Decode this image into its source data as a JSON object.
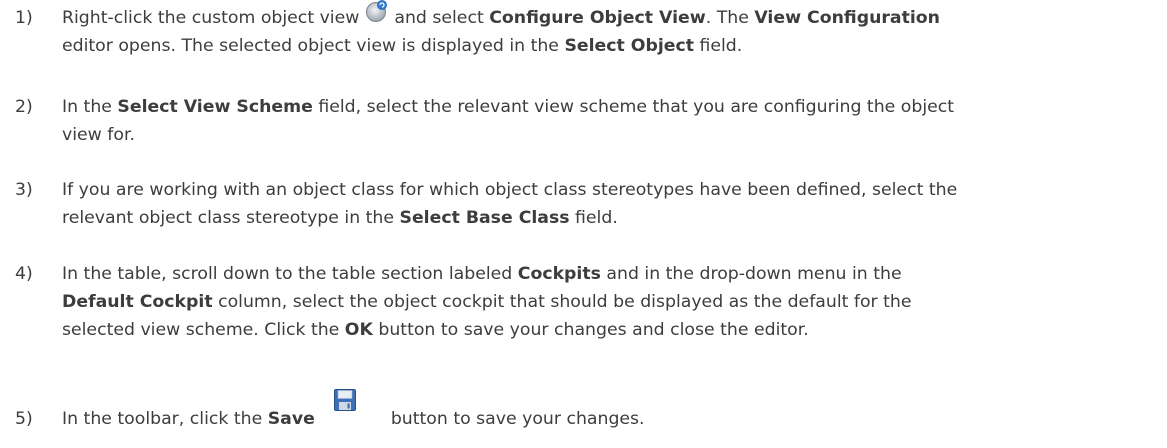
{
  "steps": [
    {
      "number": "1)",
      "line1": {
        "a": "Right-click the custom object view ",
        "b": " and select ",
        "c": "Configure Object View",
        "d": ". The ",
        "e": "View Configuration"
      },
      "line2": {
        "a": "editor opens. The selected object view is displayed in the ",
        "b": "Select Object",
        "c": " field."
      }
    },
    {
      "number": "2)",
      "line1": {
        "a": "In the ",
        "b": "Select View Scheme",
        "c": " field, select the relevant view scheme that you are configuring the object"
      },
      "line2": {
        "a": "view for."
      }
    },
    {
      "number": "3)",
      "line1": {
        "a": "If you are working with an object class for which object class stereotypes have been defined, select the"
      },
      "line2": {
        "a": "relevant object class stereotype in the ",
        "b": "Select Base Class",
        "c": " field."
      }
    },
    {
      "number": "4)",
      "line1": {
        "a": "In the table, scroll down to the table section labeled ",
        "b": "Cockpits",
        "c": " and in the drop-down menu in the"
      },
      "line2": {
        "a": "Default Cockpit",
        "b": " column, select the object cockpit that should be displayed as the default for the"
      },
      "line3": {
        "a": "selected view scheme. Click the ",
        "b": "OK",
        "c": " button to save your changes and close the editor."
      }
    },
    {
      "number": "5)",
      "line1": {
        "a": "In the toolbar, click the ",
        "b": "Save",
        "c": "button to save your changes."
      }
    }
  ],
  "icons": {
    "step1": "custom-object-view-icon",
    "step5": "save-icon"
  }
}
